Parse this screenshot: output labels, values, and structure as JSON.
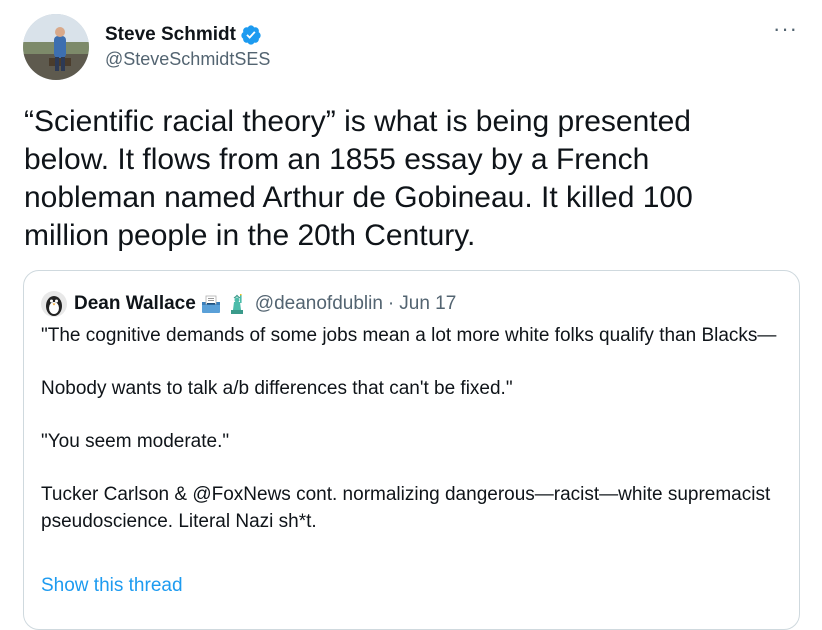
{
  "author": {
    "name": "Steve Schmidt",
    "handle": "@SteveSchmidtSES",
    "verified": true,
    "verified_color": "#1d9bf0",
    "more_label": "···"
  },
  "tweet": {
    "text": "“Scientific racial theory” is what is being presented\nbelow. It flows from an 1855 essay by a French\nnobleman named Arthur de Gobineau. It killed 100\nmillion people in the 20th Century."
  },
  "quote": {
    "name": "Dean Wallace",
    "emojis": [
      "ballot-box-emoji",
      "statue-of-liberty-emoji"
    ],
    "handle": "@deanofdublin",
    "separator": "·",
    "date": "Jun 17",
    "paragraphs": [
      "\"The cognitive demands of some jobs mean a lot more white folks qualify than Blacks—",
      "Nobody wants to talk a/b differences that can't be fixed.\"",
      "\"You seem moderate.\"",
      "Tucker Carlson & @FoxNews cont. normalizing dangerous—racist—white supremacist pseudoscience. Literal Nazi sh*t."
    ],
    "show_thread": "Show this thread"
  },
  "colors": {
    "text": "#0f1419",
    "secondary": "#536471",
    "link": "#1d9bf0",
    "border": "#cfd9de"
  }
}
